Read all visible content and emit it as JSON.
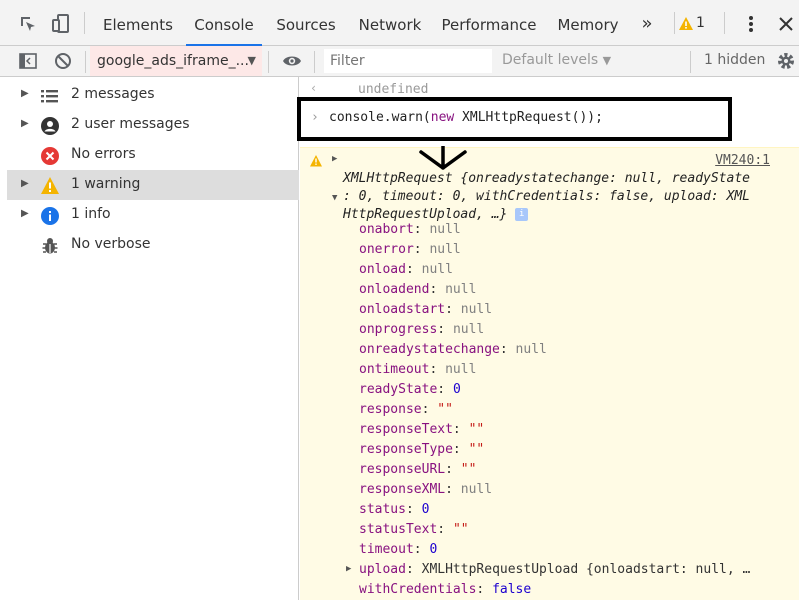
{
  "tabs": [
    {
      "label": "Elements"
    },
    {
      "label": "Console"
    },
    {
      "label": "Sources"
    },
    {
      "label": "Network"
    },
    {
      "label": "Performance"
    },
    {
      "label": "Memory"
    }
  ],
  "more_tabs": "»",
  "warning_count": "1",
  "toolbar": {
    "context": "google_ads_iframe_...",
    "filter_placeholder": "Filter",
    "levels": "Default levels",
    "hidden": "1 hidden"
  },
  "sidebar": {
    "items": [
      {
        "label": "2 messages",
        "icon": "list-icon"
      },
      {
        "label": "2 user messages",
        "icon": "user-icon"
      },
      {
        "label": "No errors",
        "icon": "error-icon"
      },
      {
        "label": "1 warning",
        "icon": "warning-icon"
      },
      {
        "label": "1 info",
        "icon": "info-icon"
      },
      {
        "label": "No verbose",
        "icon": "bug-icon"
      }
    ]
  },
  "console": {
    "undefined_text": "undefined",
    "command_prefix": "console.warn(",
    "command_keyword": "new",
    "command_suffix": " XMLHttpRequest());",
    "source_link": "VM240:1",
    "summary_class": "XMLHttpRequest",
    "summary_line1": " {onreadystatechange: null, readyState",
    "summary_line2": ": 0, timeout: 0, withCredentials: false, upload: XML",
    "summary_line3": "HttpRequestUpload, …}",
    "info_badge": "i",
    "properties": [
      {
        "key": "onabort",
        "value": "null",
        "type": "null"
      },
      {
        "key": "onerror",
        "value": "null",
        "type": "null"
      },
      {
        "key": "onload",
        "value": "null",
        "type": "null"
      },
      {
        "key": "onloadend",
        "value": "null",
        "type": "null"
      },
      {
        "key": "onloadstart",
        "value": "null",
        "type": "null"
      },
      {
        "key": "onprogress",
        "value": "null",
        "type": "null"
      },
      {
        "key": "onreadystatechange",
        "value": "null",
        "type": "null"
      },
      {
        "key": "ontimeout",
        "value": "null",
        "type": "null"
      },
      {
        "key": "readyState",
        "value": "0",
        "type": "num"
      },
      {
        "key": "response",
        "value": "\"\"",
        "type": "str"
      },
      {
        "key": "responseText",
        "value": "\"\"",
        "type": "str"
      },
      {
        "key": "responseType",
        "value": "\"\"",
        "type": "str"
      },
      {
        "key": "responseURL",
        "value": "\"\"",
        "type": "str"
      },
      {
        "key": "responseXML",
        "value": "null",
        "type": "null"
      },
      {
        "key": "status",
        "value": "0",
        "type": "num"
      },
      {
        "key": "statusText",
        "value": "\"\"",
        "type": "str"
      },
      {
        "key": "timeout",
        "value": "0",
        "type": "num"
      },
      {
        "key": "upload",
        "value": "XMLHttpRequestUpload {onloadstart: null, …",
        "type": "obj"
      },
      {
        "key": "withCredentials",
        "value": "false",
        "type": "num"
      }
    ]
  },
  "colors": {
    "accent": "#1a73e8",
    "warning_bg": "#fffbe5",
    "context_bg": "#fde8e7",
    "error_red": "#e53935",
    "warning_yellow": "#f4b400",
    "info_blue": "#1a73e8"
  }
}
